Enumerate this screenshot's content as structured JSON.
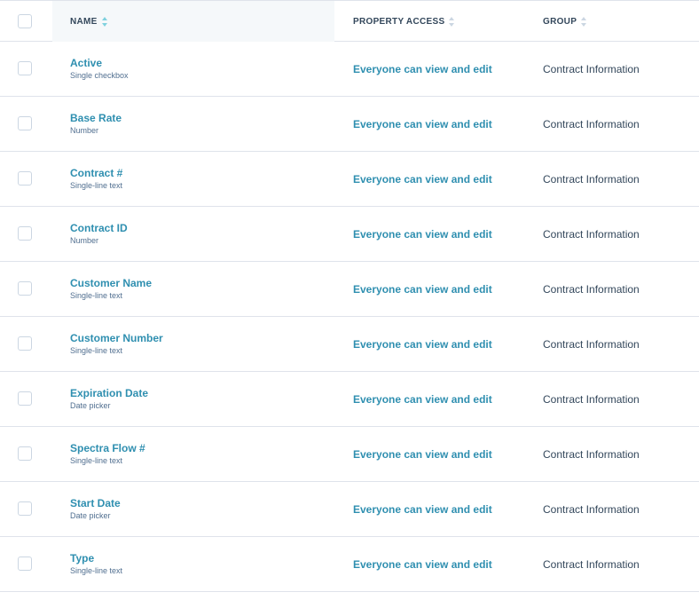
{
  "columns": {
    "name": "NAME",
    "access": "PROPERTY ACCESS",
    "group": "GROUP"
  },
  "rows": [
    {
      "name": "Active",
      "type": "Single checkbox",
      "access": "Everyone can view and edit",
      "group": "Contract Information"
    },
    {
      "name": "Base Rate",
      "type": "Number",
      "access": "Everyone can view and edit",
      "group": "Contract Information"
    },
    {
      "name": "Contract #",
      "type": "Single-line text",
      "access": "Everyone can view and edit",
      "group": "Contract Information"
    },
    {
      "name": "Contract ID",
      "type": "Number",
      "access": "Everyone can view and edit",
      "group": "Contract Information"
    },
    {
      "name": "Customer Name",
      "type": "Single-line text",
      "access": "Everyone can view and edit",
      "group": "Contract Information"
    },
    {
      "name": "Customer Number",
      "type": "Single-line text",
      "access": "Everyone can view and edit",
      "group": "Contract Information"
    },
    {
      "name": "Expiration Date",
      "type": "Date picker",
      "access": "Everyone can view and edit",
      "group": "Contract Information"
    },
    {
      "name": "Spectra Flow #",
      "type": "Single-line text",
      "access": "Everyone can view and edit",
      "group": "Contract Information"
    },
    {
      "name": "Start Date",
      "type": "Date picker",
      "access": "Everyone can view and edit",
      "group": "Contract Information"
    },
    {
      "name": "Type",
      "type": "Single-line text",
      "access": "Everyone can view and edit",
      "group": "Contract Information"
    }
  ],
  "colors": {
    "link": "#2f8fb0",
    "text": "#33475b",
    "border": "#dfe3eb",
    "header_highlight": "#f5f8fa"
  }
}
